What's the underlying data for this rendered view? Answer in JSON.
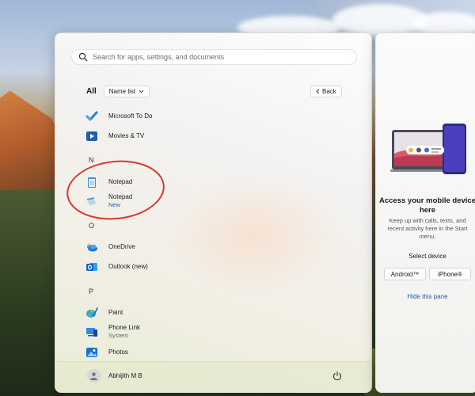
{
  "search": {
    "placeholder": "Search for apps, settings, and documents"
  },
  "list_header": {
    "all_label": "All",
    "view_label": "Name list",
    "back_label": "Back"
  },
  "apps": [
    {
      "name": "Microsoft To Do",
      "icon": "todo-checkmark-icon"
    },
    {
      "name": "Movies & TV",
      "icon": "movies-tv-icon"
    },
    {
      "letter": "N"
    },
    {
      "name": "Notepad",
      "icon": "notepad-icon"
    },
    {
      "name": "Notepad",
      "badge": "New",
      "icon": "notepad-new-icon"
    },
    {
      "letter": "O"
    },
    {
      "name": "OneDrive",
      "icon": "onedrive-cloud-icon"
    },
    {
      "name": "Outlook (new)",
      "icon": "outlook-icon"
    },
    {
      "letter": "P"
    },
    {
      "name": "Paint",
      "icon": "paint-icon"
    },
    {
      "name": "Phone Link",
      "subtitle": "System",
      "icon": "phone-link-icon"
    },
    {
      "name": "Photos",
      "icon": "photos-icon"
    }
  ],
  "footer": {
    "user_name": "Abhijith M B",
    "user_icon": "user-avatar-icon",
    "power_icon": "power-icon"
  },
  "side_panel": {
    "title": "Access your mobile device here",
    "description": "Keep up with calls, texts, and recent activity here in the Start menu.",
    "select_label": "Select device",
    "devices": [
      "Android™",
      "iPhone®"
    ],
    "hide_label": "Hide this pane"
  },
  "colors": {
    "accent_link": "#1f5fa7",
    "annotation": "#d8392b"
  }
}
